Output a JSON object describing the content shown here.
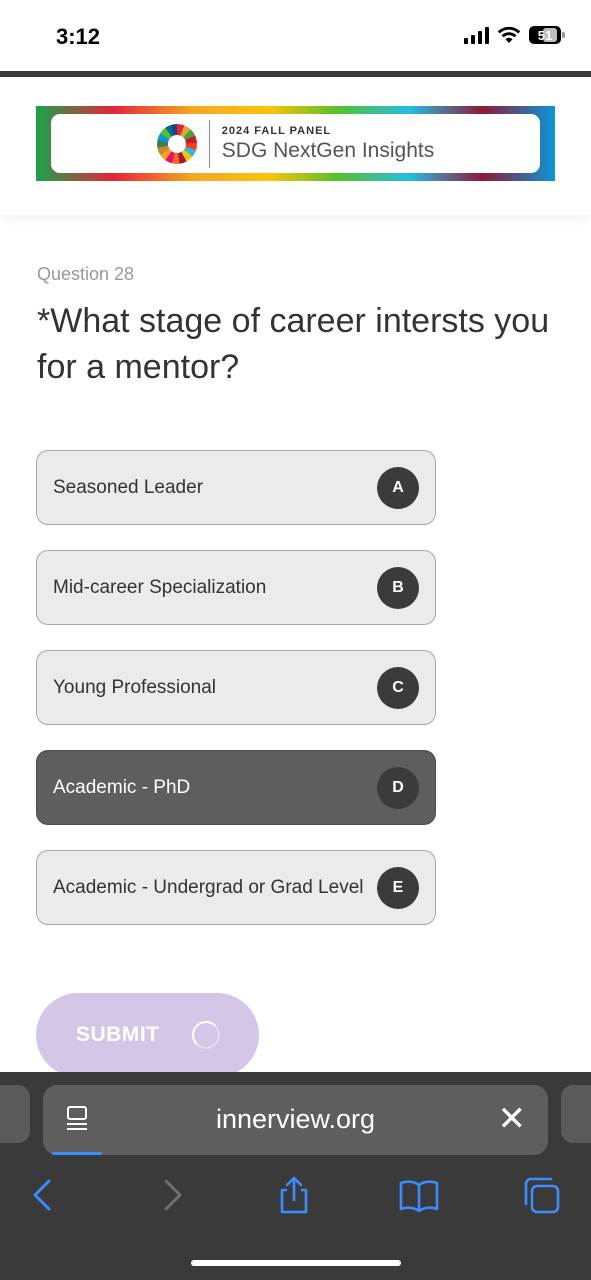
{
  "status_bar": {
    "time": "3:12",
    "battery": "51"
  },
  "banner": {
    "subtitle": "2024 FALL PANEL",
    "title": "SDG NextGen Insights"
  },
  "question": {
    "number_label": "Question 28",
    "text": "*What stage of career intersts you for a mentor?"
  },
  "options": [
    {
      "label": "Seasoned Leader",
      "key": "A",
      "selected": false
    },
    {
      "label": "Mid-career Specialization",
      "key": "B",
      "selected": false
    },
    {
      "label": "Young Professional",
      "key": "C",
      "selected": false
    },
    {
      "label": "Academic - PhD",
      "key": "D",
      "selected": true
    },
    {
      "label": "Academic - Undergrad or Grad Level",
      "key": "E",
      "selected": false
    }
  ],
  "submit": {
    "label": "SUBMIT"
  },
  "browser": {
    "url": "innerview.org"
  },
  "colors": {
    "accent": "#3b8cff",
    "selected_option": "#5e5e5e",
    "submit_bg": "#d4c6e6"
  },
  "icons": {
    "toolbar": [
      "back-icon",
      "forward-icon",
      "share-icon",
      "bookmarks-icon",
      "tabs-icon"
    ]
  }
}
